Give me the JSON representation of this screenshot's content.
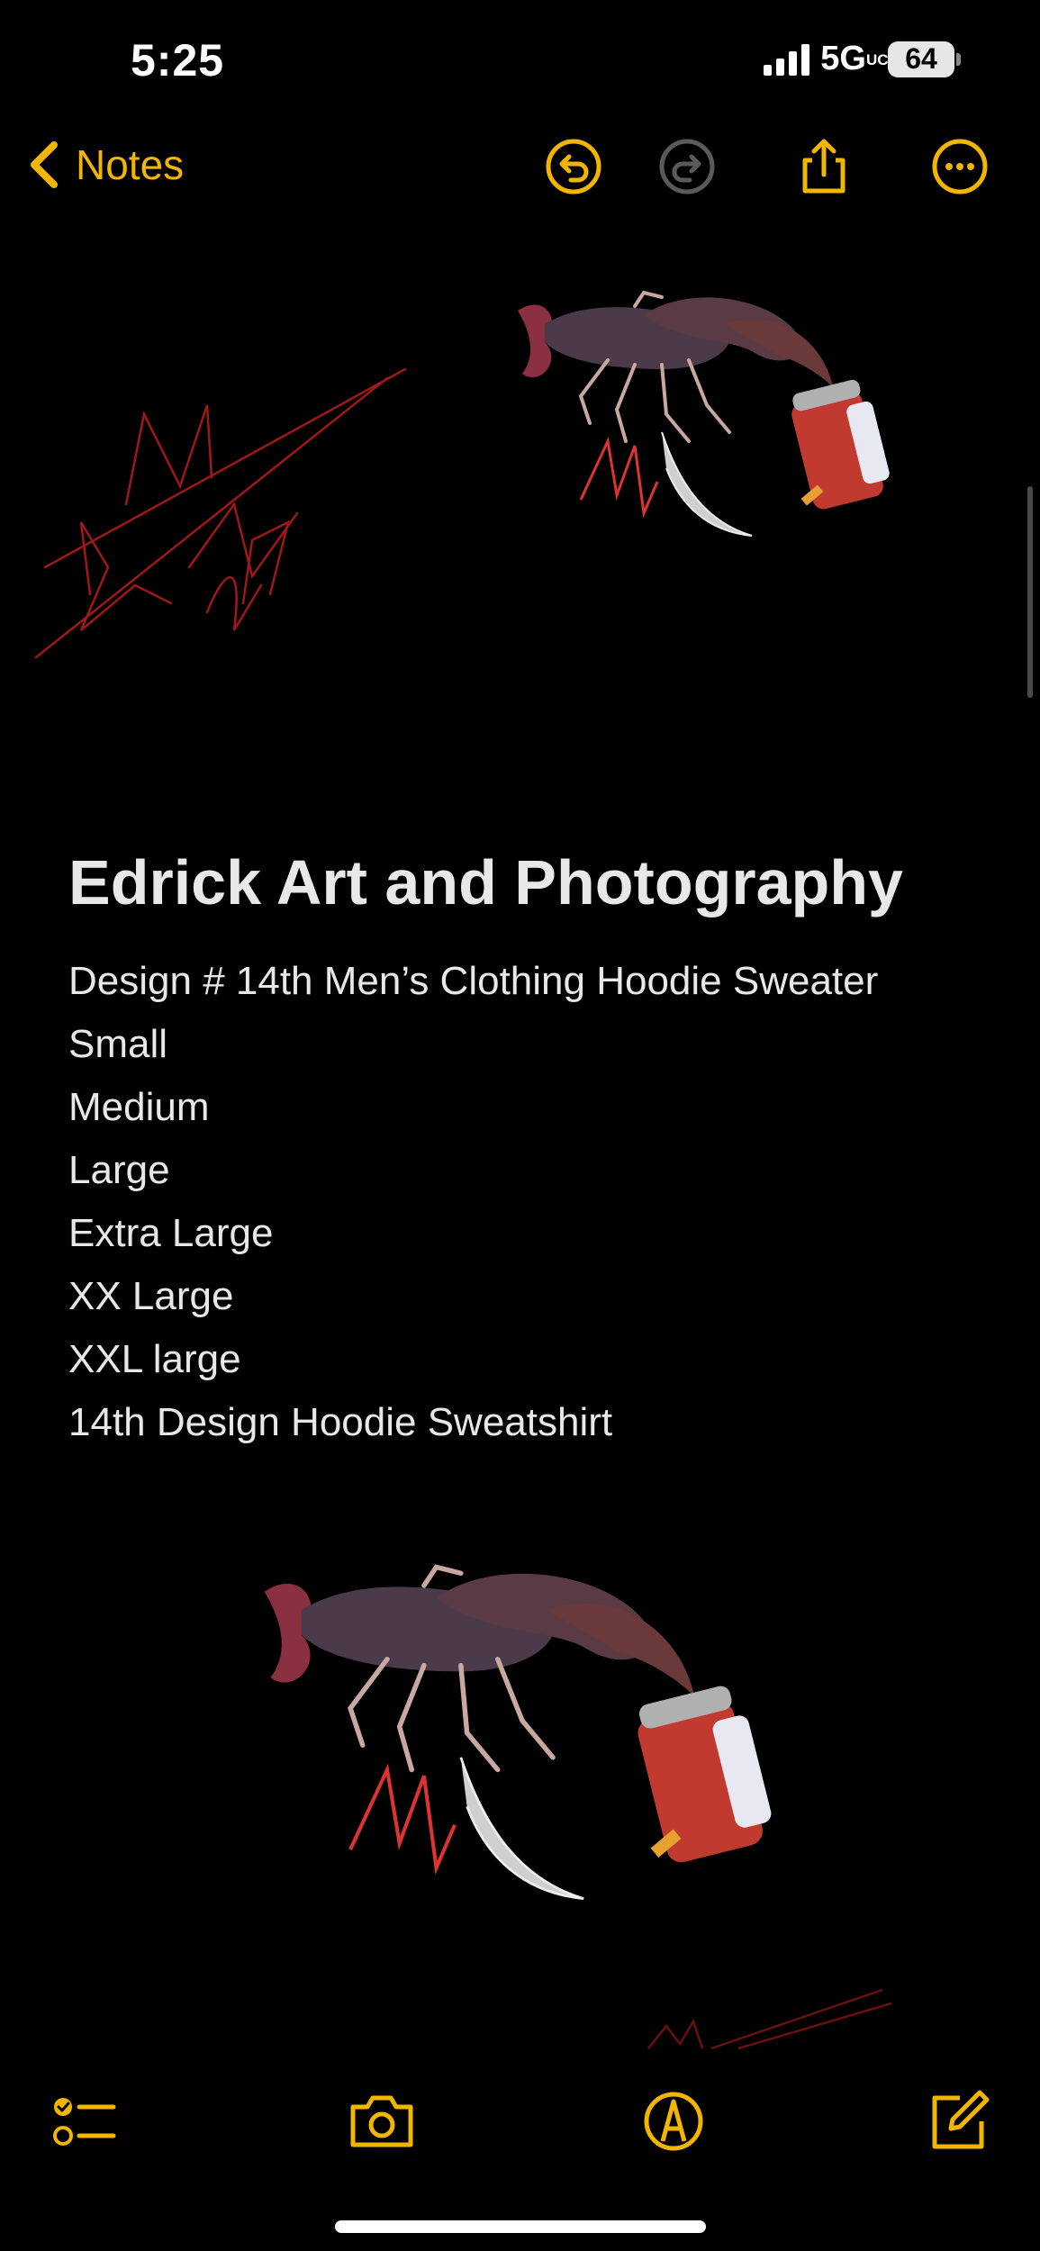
{
  "status_bar": {
    "time": "5:25",
    "network": "5G",
    "network_suffix": "UC",
    "battery": "64"
  },
  "nav": {
    "back_label": "Notes",
    "icons": [
      "chevron-left-icon",
      "undo-icon",
      "redo-icon",
      "share-icon",
      "more-icon"
    ]
  },
  "note": {
    "title": "Edrick Art and Photography",
    "lines": [
      "Design # 14th Men’s Clothing Hoodie Sweater",
      "Small",
      "Medium",
      "Large",
      "Extra Large",
      "XX Large",
      "XXL large",
      "14th Design Hoodie Sweatshirt"
    ],
    "images": [
      "crayfish-art-image",
      "signature-drawing"
    ]
  },
  "toolbar": {
    "icons": [
      "checklist-icon",
      "camera-icon",
      "markup-icon",
      "compose-icon"
    ]
  },
  "colors": {
    "accent": "#f2b600",
    "background": "#000000",
    "text": "#e8e8e8",
    "disabled": "#5a5a5a",
    "signature": "#a01818"
  }
}
